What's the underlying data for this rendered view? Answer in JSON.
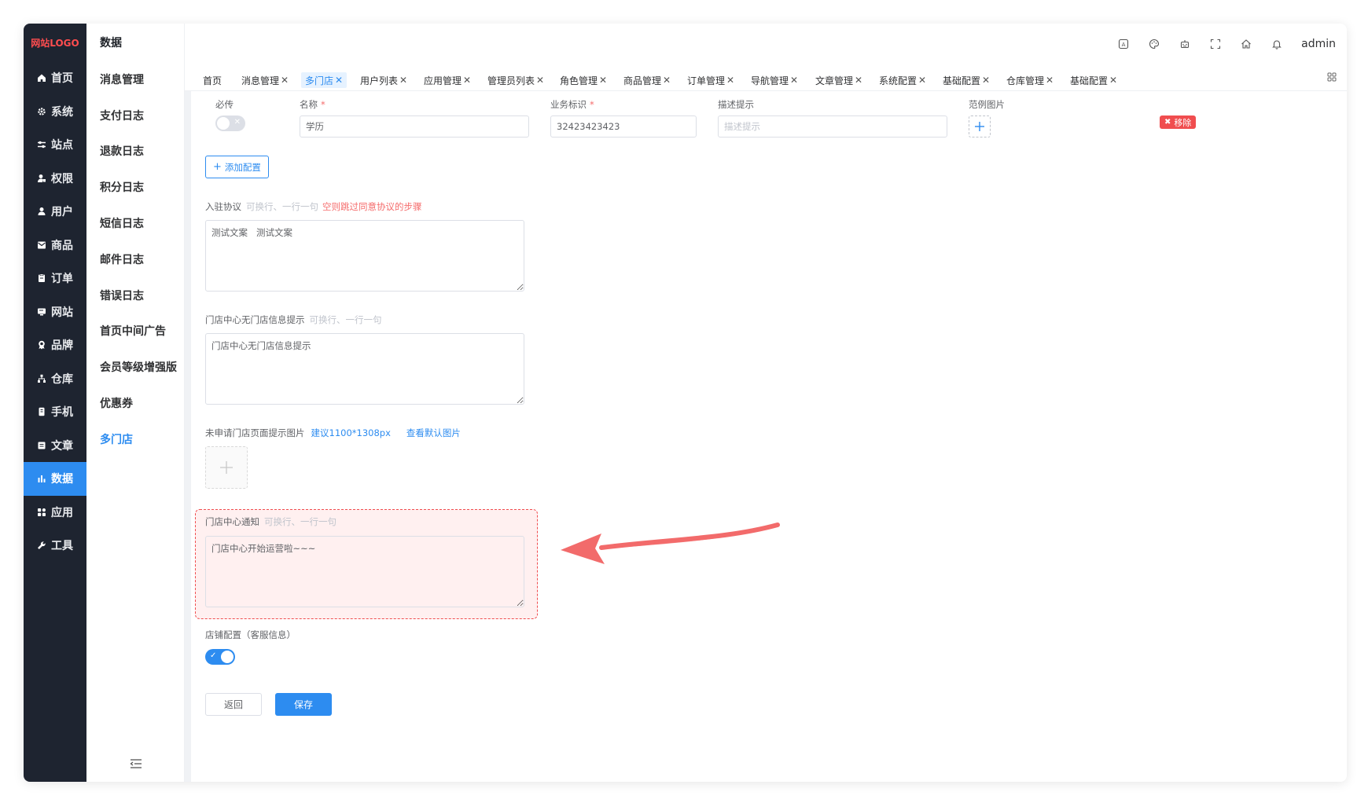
{
  "logo": {
    "text": "网站LOGO"
  },
  "sidebar": {
    "items": [
      {
        "label": "首页",
        "icon": "home-icon"
      },
      {
        "label": "系统",
        "icon": "gear-icon"
      },
      {
        "label": "站点",
        "icon": "sliders-icon"
      },
      {
        "label": "权限",
        "icon": "user-key-icon"
      },
      {
        "label": "用户",
        "icon": "user-icon"
      },
      {
        "label": "商品",
        "icon": "mail-icon"
      },
      {
        "label": "订单",
        "icon": "clipboard-icon"
      },
      {
        "label": "网站",
        "icon": "monitor-icon"
      },
      {
        "label": "品牌",
        "icon": "award-icon"
      },
      {
        "label": "仓库",
        "icon": "sitemap-icon"
      },
      {
        "label": "手机",
        "icon": "phone-icon"
      },
      {
        "label": "文章",
        "icon": "document-icon"
      },
      {
        "label": "数据",
        "icon": "bar-chart-icon"
      },
      {
        "label": "应用",
        "icon": "grid-icon"
      },
      {
        "label": "工具",
        "icon": "wrench-icon"
      }
    ],
    "active": "数据"
  },
  "submenu": {
    "title": "数据",
    "items": [
      "消息管理",
      "支付日志",
      "退款日志",
      "积分日志",
      "短信日志",
      "邮件日志",
      "错误日志",
      "首页中间广告",
      "会员等级增强版",
      "优惠券",
      "多门店"
    ],
    "active": "多门店"
  },
  "topbar": {
    "user": "admin",
    "icons": [
      "translate-icon",
      "palette-icon",
      "robot-icon",
      "fullscreen-icon",
      "home-icon",
      "bell-icon"
    ]
  },
  "tabs": [
    {
      "label": "首页",
      "closable": false
    },
    {
      "label": "消息管理",
      "closable": true
    },
    {
      "label": "多门店",
      "closable": true,
      "active": true
    },
    {
      "label": "用户列表",
      "closable": true
    },
    {
      "label": "应用管理",
      "closable": true
    },
    {
      "label": "管理员列表",
      "closable": true
    },
    {
      "label": "角色管理",
      "closable": true
    },
    {
      "label": "商品管理",
      "closable": true
    },
    {
      "label": "订单管理",
      "closable": true
    },
    {
      "label": "导航管理",
      "closable": true
    },
    {
      "label": "文章管理",
      "closable": true
    },
    {
      "label": "系统配置",
      "closable": true
    },
    {
      "label": "基础配置",
      "closable": true
    },
    {
      "label": "仓库管理",
      "closable": true
    },
    {
      "label": "基础配置",
      "closable": true
    }
  ],
  "config_row": {
    "required_label": "必传",
    "name_label": "名称",
    "name_value": "学历",
    "key_label": "业务标识",
    "key_value": "32423423423",
    "desc_label": "描述提示",
    "desc_placeholder": "描述提示",
    "image_label": "范例图片",
    "remove_label": "移除",
    "required_on": false
  },
  "add_config_label": "添加配置",
  "agreement": {
    "label": "入驻协议",
    "hint": "可换行、一行一句",
    "hint_red": "空则跳过同意协议的步骤",
    "value": "测试文案   测试文案"
  },
  "no_store_tip": {
    "label": "门店中心无门店信息提示",
    "hint": "可换行、一行一句",
    "value": "门店中心无门店信息提示"
  },
  "unapplied_image": {
    "label": "未申请门店页面提示图片",
    "size_hint": "建议1100*1308px",
    "view_default": "查看默认图片"
  },
  "store_notice": {
    "label": "门店中心通知",
    "hint": "可换行、一行一句",
    "value": "门店中心开始运营啦~~~"
  },
  "shop_config": {
    "label": "店铺配置（客服信息）",
    "enabled": true
  },
  "actions": {
    "back": "返回",
    "save": "保存"
  },
  "colors": {
    "primary": "#2d8cf0",
    "sidebar_bg": "#1e2430",
    "danger": "#f04d4f",
    "highlight_bg": "#fff0f0"
  }
}
